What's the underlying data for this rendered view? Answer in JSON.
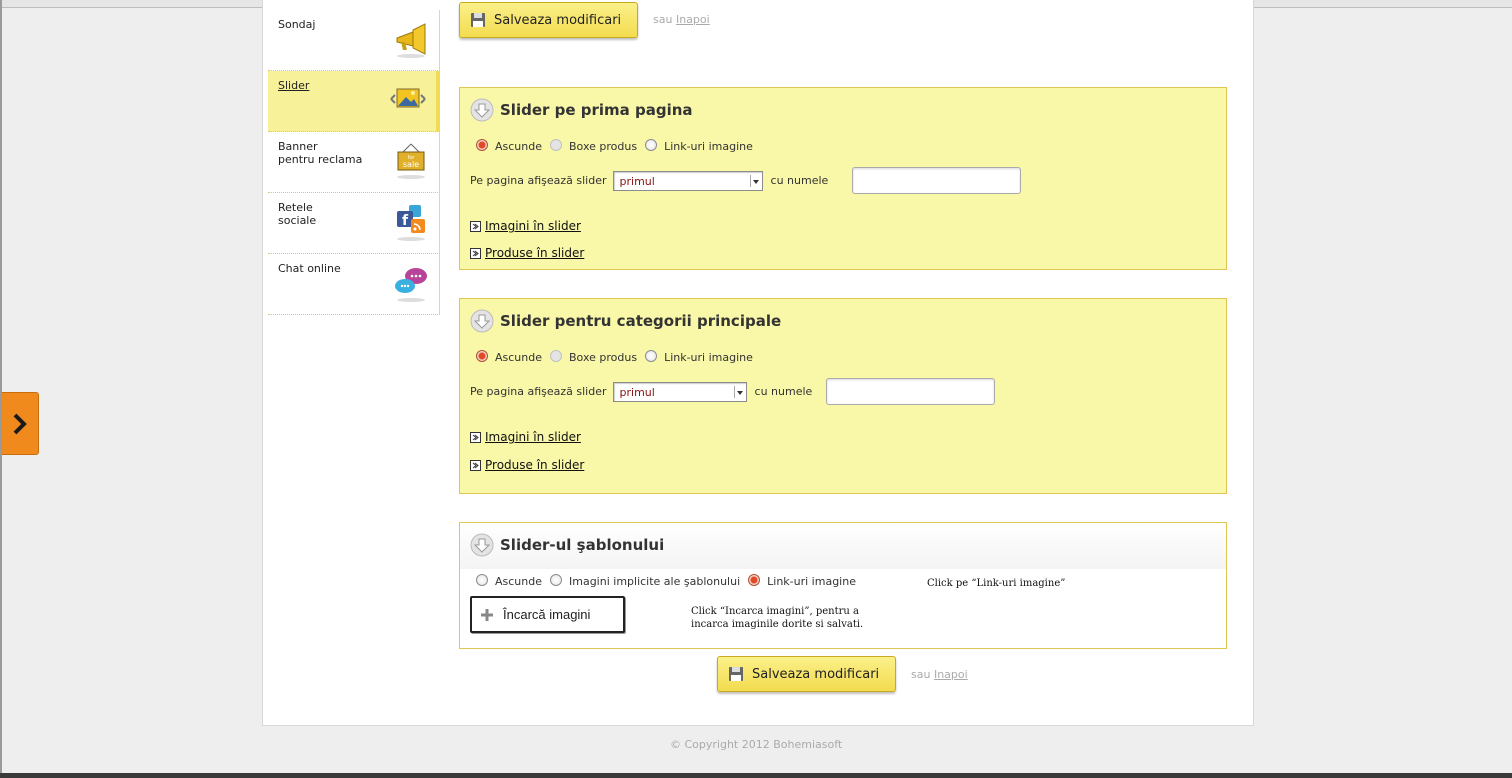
{
  "menu": {
    "items": [
      {
        "label": "Sondaj",
        "icon": "megaphone-icon"
      },
      {
        "label": "Slider",
        "icon": "slider-image-icon",
        "active": true
      },
      {
        "label": "Banner\npentru reclama",
        "icon": "for-sale-sign-icon"
      },
      {
        "label": "Retele\nsociale",
        "icon": "social-networks-icon"
      },
      {
        "label": "Chat online",
        "icon": "chat-bubbles-icon"
      }
    ]
  },
  "toolbar": {
    "save_label": "Salveaza modificari",
    "or_text": "sau",
    "back_label": "Inapoi"
  },
  "panel_home": {
    "title": "Slider pe prima pagina",
    "radios": [
      {
        "label": "Ascunde",
        "state": "checked"
      },
      {
        "label": "Boxe produs",
        "state": "disabled"
      },
      {
        "label": "Link-uri imagine",
        "state": "unchecked"
      }
    ],
    "select_label": "Pe pagina afişează slider",
    "select_value": "primul",
    "name_label": "cu numele",
    "name_value": "",
    "link_images": "Imagini în slider",
    "link_products": "Produse în slider"
  },
  "panel_categories": {
    "title": "Slider pentru categorii principale",
    "radios": [
      {
        "label": "Ascunde",
        "state": "checked"
      },
      {
        "label": "Boxe produs",
        "state": "disabled"
      },
      {
        "label": "Link-uri imagine",
        "state": "unchecked"
      }
    ],
    "select_label": "Pe pagina afişează slider",
    "select_value": "primul",
    "name_label": "cu numele",
    "name_value": "",
    "link_images": "Imagini în slider",
    "link_products": "Produse în slider"
  },
  "panel_template": {
    "title": "Slider-ul şablonului",
    "radios": [
      {
        "label": "Ascunde",
        "state": "unchecked"
      },
      {
        "label": "Imagini implicite ale şablonului",
        "state": "unchecked"
      },
      {
        "label": "Link-uri imagine",
        "state": "checked"
      }
    ],
    "note_right": "Click pe “Link-uri imagine”",
    "upload_label": "Încarcă imagini",
    "note_upload": "Click “Incarca imagini”, pentru a\nincarca imaginile dorite si salvati."
  },
  "footer": {
    "copyright": "© Copyright 2012 Bohemiasoft"
  },
  "colors": {
    "panel_yellow": "#f9f7a8",
    "accent_orange": "#f08a1c",
    "button_yellow": "#f3dc4f",
    "radio_checked": "#e04a28"
  }
}
